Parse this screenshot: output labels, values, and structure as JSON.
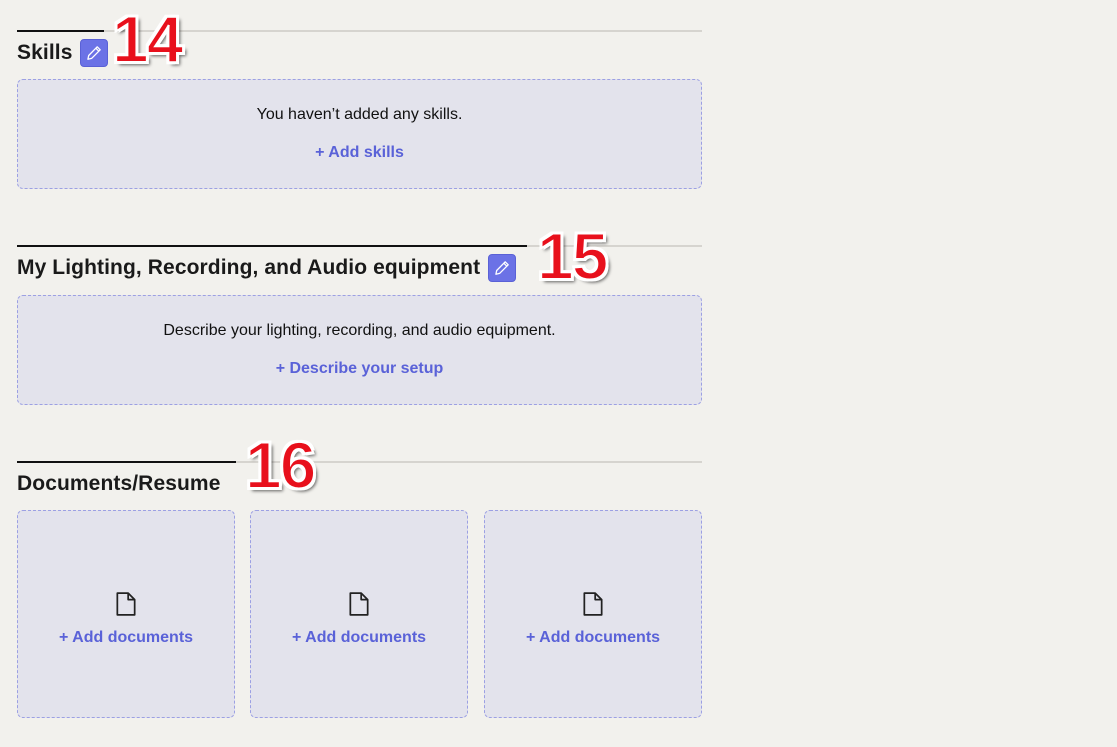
{
  "colors": {
    "background": "#f2f1ed",
    "accent": "#6b72e6",
    "link": "#5a62d8",
    "card_bg": "#e3e3ec",
    "marker": "#e8101c"
  },
  "skills": {
    "title": "Skills",
    "edit_icon": "pencil-icon",
    "empty_message": "You haven’t added any skills.",
    "add_label": "+ Add skills"
  },
  "equipment": {
    "title": "My Lighting, Recording, and Audio equipment",
    "edit_icon": "pencil-icon",
    "empty_message": "Describe your lighting, recording, and audio equipment.",
    "add_label": "+ Describe your setup"
  },
  "documents": {
    "title": "Documents/Resume",
    "slots": [
      {
        "icon": "document-icon",
        "label": "+ Add documents"
      },
      {
        "icon": "document-icon",
        "label": "+ Add documents"
      },
      {
        "icon": "document-icon",
        "label": "+ Add documents"
      }
    ]
  },
  "markers": [
    "14",
    "15",
    "16"
  ]
}
